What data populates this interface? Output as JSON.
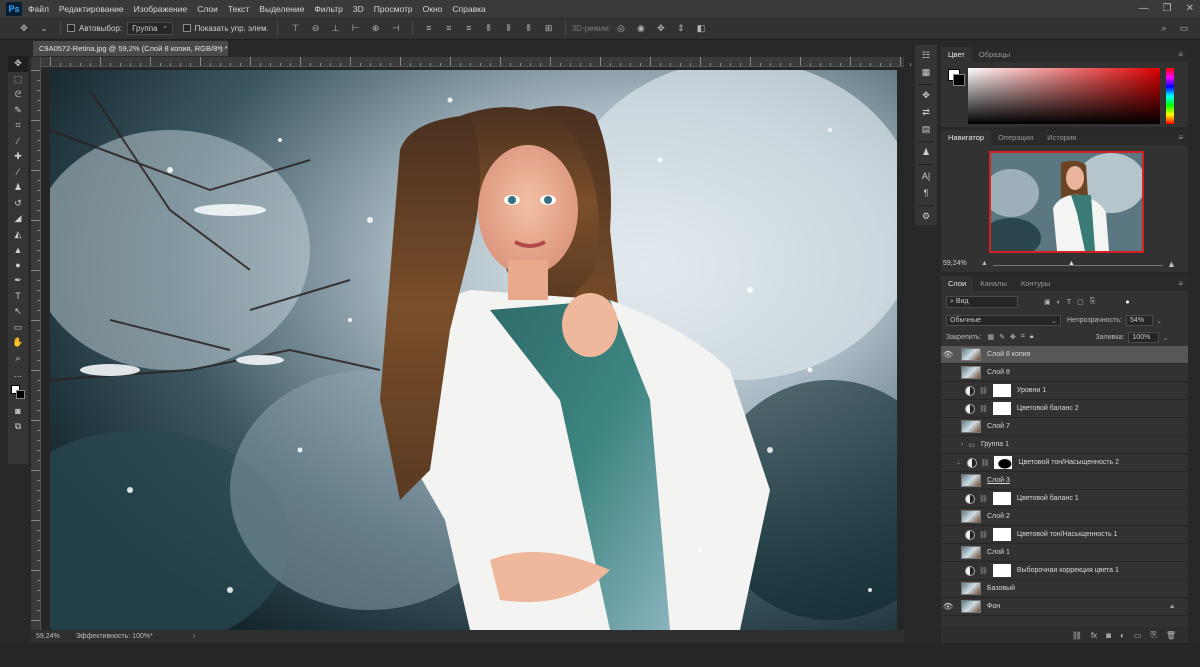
{
  "app": {
    "logo": "Ps",
    "menu": [
      "Файл",
      "Редактирование",
      "Изображение",
      "Слои",
      "Текст",
      "Выделение",
      "Фильтр",
      "3D",
      "Просмотр",
      "Окно",
      "Справка"
    ],
    "window_buttons": [
      "—",
      "❐",
      "✕"
    ]
  },
  "options": {
    "autoselect_label": "Автовыбор:",
    "autoselect_value": "Группа",
    "show_transform_label": "Показать упр. элем.",
    "mode_3d_label": "3D-режим:"
  },
  "document": {
    "tab_title": "C9A0572-Retina.jpg @ 59,2% (Слой 8 копия, RGB/8*) *",
    "close": "×"
  },
  "status": {
    "zoom": "59,24%",
    "efficiency": "Эффективность: 100%*",
    "arrow": "›"
  },
  "panels": {
    "color_tabs": [
      "Цвет",
      "Образцы"
    ],
    "navigator_tabs": [
      "Навигатор",
      "Операции",
      "История"
    ],
    "navigator_zoom": "59,24%",
    "layers_tabs": [
      "Слои",
      "Каналы",
      "Контуры"
    ],
    "filter_kind": "Вид",
    "blend_mode": "Обычные",
    "opacity_label": "Непрозрачность:",
    "opacity_value": "54%",
    "lock_label": "Закрепить:",
    "fill_label": "Заливка:",
    "fill_value": "100%"
  },
  "layers": [
    {
      "name": "Слой 8 копия",
      "type": "pixel",
      "visible": true,
      "selected": true
    },
    {
      "name": "Слой 8",
      "type": "pixel",
      "visible": false
    },
    {
      "name": "Уровни 1",
      "type": "adjustment",
      "visible": false
    },
    {
      "name": "Цветовой баланс 2",
      "type": "adjustment",
      "visible": false
    },
    {
      "name": "Слой 7",
      "type": "pixel",
      "visible": false
    },
    {
      "name": "Группа 1",
      "type": "group",
      "visible": false
    },
    {
      "name": "Цветовой тон/Насыщенность 2",
      "type": "adjustment-dark",
      "visible": false
    },
    {
      "name": "Слой 3",
      "type": "pixel",
      "visible": false
    },
    {
      "name": "Цветовой баланс 1",
      "type": "adjustment",
      "visible": false
    },
    {
      "name": "Слой 2",
      "type": "pixel",
      "visible": false
    },
    {
      "name": "Цветовой тон/Насыщенность 1",
      "type": "adjustment",
      "visible": false
    },
    {
      "name": "Слой 1",
      "type": "pixel",
      "visible": false
    },
    {
      "name": "Выборочная коррекция цвета 1",
      "type": "adjustment",
      "visible": false
    },
    {
      "name": "Базовый",
      "type": "pixel",
      "visible": false
    },
    {
      "name": "Фон",
      "type": "pixel",
      "visible": true,
      "locked": true
    }
  ],
  "colors": {
    "accent_red": "#d42121",
    "selected_row": "#575757",
    "panel_bg": "#323232"
  }
}
